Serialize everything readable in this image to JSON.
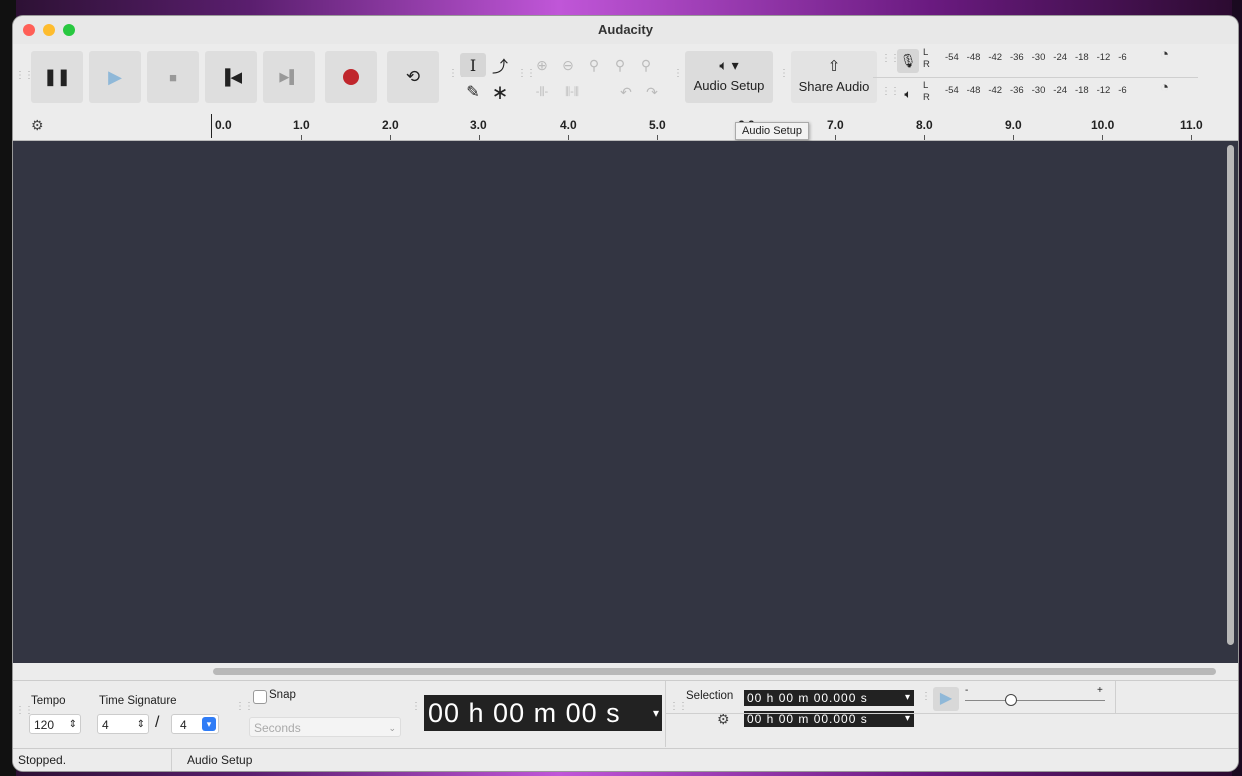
{
  "window": {
    "title": "Audacity",
    "traffic_colors": {
      "close": "#ff5f57",
      "minimize": "#febc2e",
      "maximize": "#28c840"
    }
  },
  "toolbar": {
    "audio_setup_label": "Audio Setup",
    "share_audio_label": "Share Audio",
    "meter_record_L": "L",
    "meter_record_R": "R",
    "meter_play_L": "L",
    "meter_play_R": "R",
    "meter_scale": [
      "-54",
      "-48",
      "-42",
      "-36",
      "-30",
      "-24",
      "-18",
      "-12",
      "-6"
    ]
  },
  "ruler": {
    "ticks": [
      "0.0",
      "1.0",
      "2.0",
      "3.0",
      "4.0",
      "5.0",
      "6.0",
      "7.0",
      "8.0",
      "9.0",
      "10.0",
      "11.0"
    ]
  },
  "tooltip": "Audio Setup",
  "bottom": {
    "tempo_label": "Tempo",
    "time_signature_label": "Time Signature",
    "tempo_value": "120",
    "ts_upper": "4",
    "ts_slash": "/",
    "ts_lower": "4",
    "snap_label": "Snap",
    "snap_unit": "Seconds",
    "time_display": "00 h 00 m 00 s",
    "selection_label": "Selection",
    "selection_start": "00 h 00 m 00.000 s",
    "selection_end": "00 h 00 m 00.000 s",
    "playspeed_minus": "-",
    "playspeed_plus": "+"
  },
  "status": {
    "state": "Stopped.",
    "message": "Audio Setup"
  },
  "colors": {
    "track_background": "#333542",
    "record_red": "#c0262c",
    "accent_blue": "#2f7cf6"
  }
}
